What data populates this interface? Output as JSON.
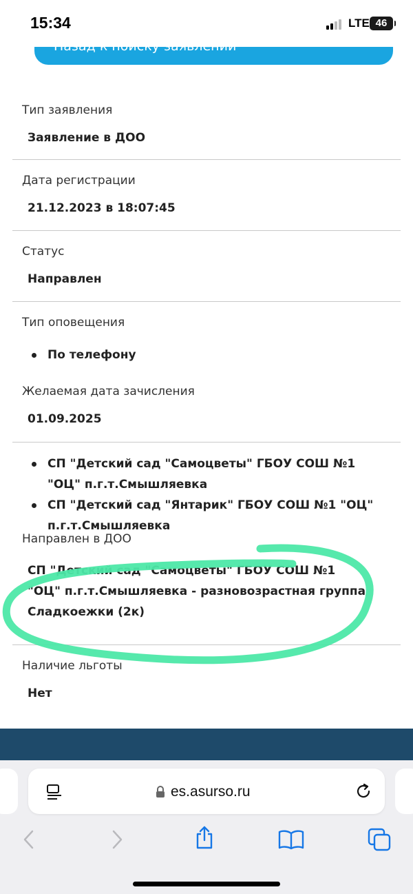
{
  "status_bar": {
    "time": "15:34",
    "network": "LTE",
    "battery": "46"
  },
  "back_button": {
    "label": "Назад к поиску заявлений"
  },
  "fields": {
    "app_type": {
      "label": "Тип заявления",
      "value": "Заявление в ДОО"
    },
    "reg_date": {
      "label": "Дата регистрации",
      "value": "21.12.2023 в 18:07:45"
    },
    "status": {
      "label": "Статус",
      "value": "Направлен"
    },
    "notify_type": {
      "label": "Тип оповещения",
      "items": [
        "По телефону"
      ]
    },
    "desired_date": {
      "label": "Желаемая дата зачисления",
      "value": "01.09.2025"
    },
    "preferred_doo": {
      "items": [
        "СП \"Детский сад \"Самоцветы\" ГБОУ СОШ №1 \"ОЦ\" п.г.т.Смышляевка",
        "СП \"Детский сад \"Янтарик\" ГБОУ СОШ №1 \"ОЦ\" п.г.т.Смышляевка"
      ]
    },
    "directed_to": {
      "label": "Направлен в ДОО",
      "value": "СП \"Детский сад \"Самоцветы\" ГБОУ СОШ №1 \"ОЦ\" п.г.т.Смышляевка - разновозрастная группа Сладкоежки (2к)"
    },
    "benefit": {
      "label": "Наличие льготы",
      "value": "Нет"
    }
  },
  "browser": {
    "url": "es.asurso.ru",
    "icons": [
      "reader-icon",
      "lock-icon",
      "reload-icon",
      "back-icon",
      "forward-icon",
      "share-icon",
      "bookmarks-icon",
      "tabs-icon"
    ]
  },
  "colors": {
    "accent": "#1aa5e0",
    "footer": "#1e4a6a",
    "highlight": "#4de8a8"
  }
}
